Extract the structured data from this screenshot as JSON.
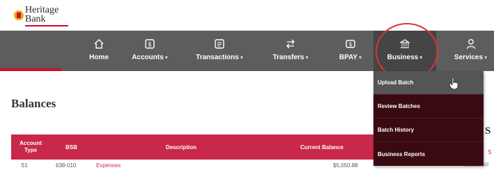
{
  "brand": {
    "line1": "Heritage",
    "line2": "Bank",
    "accent": "#c8102e"
  },
  "nav": {
    "items": [
      {
        "label": "Home",
        "icon": "home-icon",
        "has_caret": false
      },
      {
        "label": "Accounts",
        "icon": "dollar-card-icon",
        "has_caret": true
      },
      {
        "label": "Transactions",
        "icon": "receipt-icon",
        "has_caret": true
      },
      {
        "label": "Transfers",
        "icon": "transfer-arrows-icon",
        "has_caret": true
      },
      {
        "label": "BPAY",
        "icon": "bpay-icon",
        "has_caret": true
      },
      {
        "label": "Business",
        "icon": "bank-building-icon",
        "has_caret": true
      },
      {
        "label": "Services",
        "icon": "person-icon",
        "has_caret": true
      }
    ],
    "caret": "▾",
    "bar_color": "#5d5d5d"
  },
  "page": {
    "title": "Balances"
  },
  "table": {
    "headers": {
      "type_line1": "Account",
      "type_line2": "Type",
      "bsb": "BSB",
      "description": "Description",
      "balance": "Current Balance"
    },
    "rows": [
      {
        "type": "S1",
        "bsb": "638-010",
        "description": "Expenses",
        "balance": "$5,050.88"
      }
    ],
    "header_color": "#c8284a"
  },
  "right_column": {
    "heading": "S",
    "red_text": "S",
    "cell": "$5,050.88"
  },
  "business_menu": {
    "items": [
      {
        "label": "Upload Batch",
        "hover": true
      },
      {
        "label": "Review Batches",
        "hover": false
      },
      {
        "label": "Batch History",
        "hover": false
      },
      {
        "label": "Business Reports",
        "hover": false
      }
    ],
    "bg_color": "#3a0a12",
    "hover_color": "#555555"
  }
}
